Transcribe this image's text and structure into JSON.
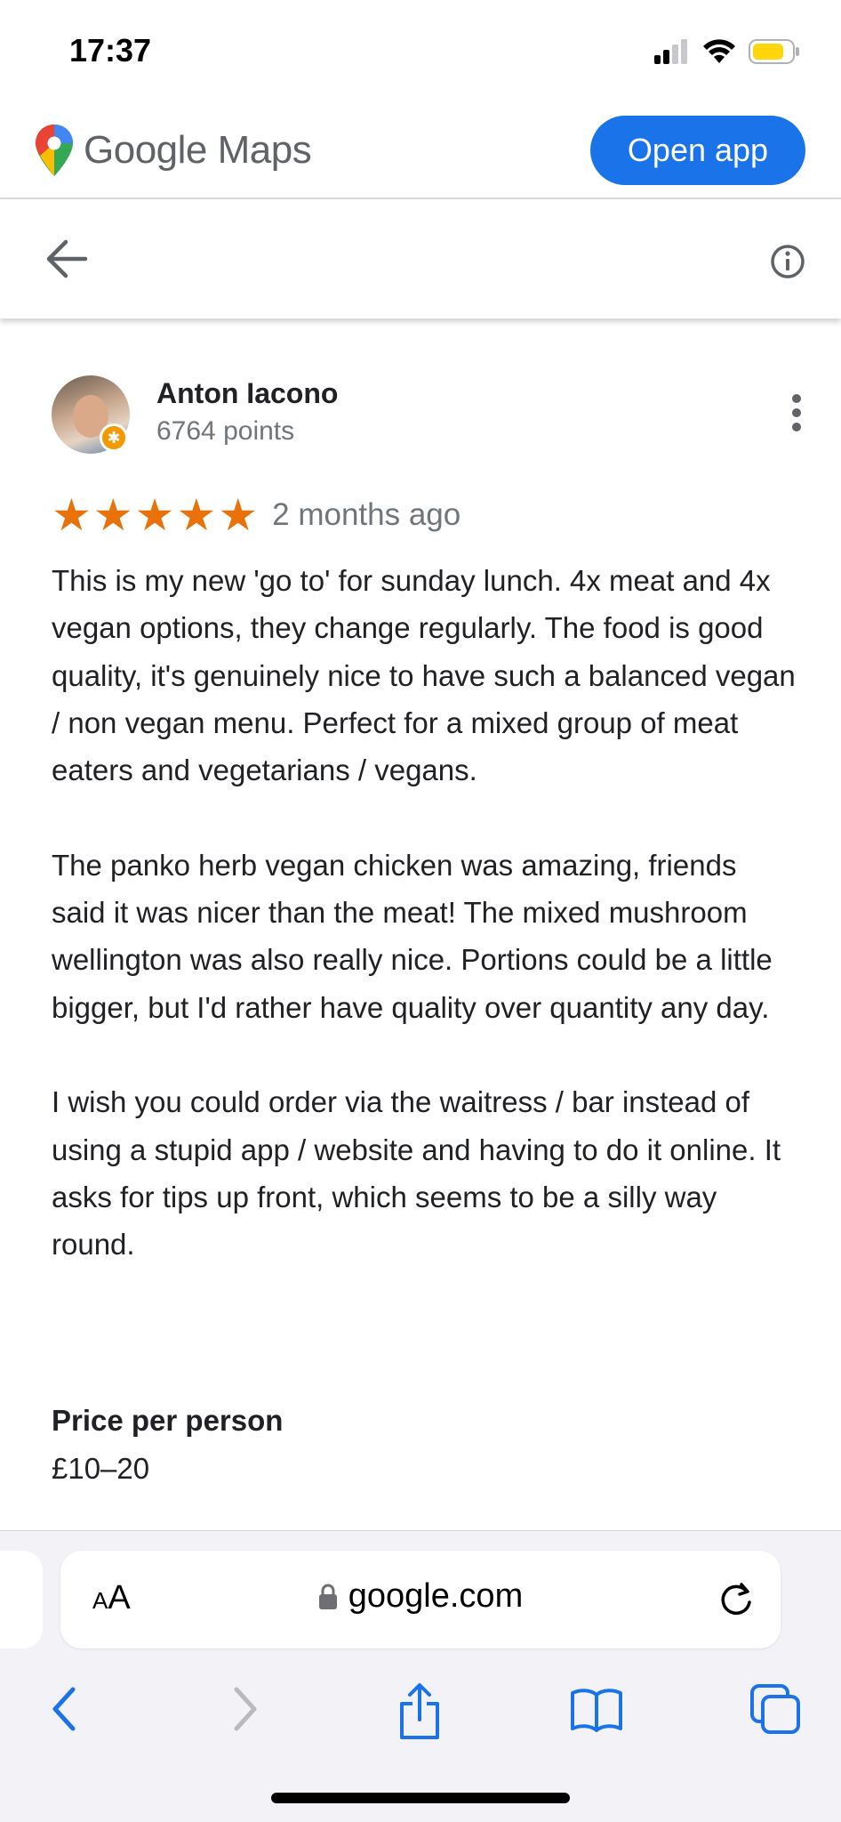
{
  "status_bar": {
    "time": "17:37",
    "icons": [
      "signal-icon",
      "wifi-icon",
      "battery-icon"
    ]
  },
  "header": {
    "brand": "Google Maps",
    "open_app_label": "Open app"
  },
  "nav": {
    "icons": [
      "back-arrow-icon",
      "info-icon"
    ]
  },
  "review": {
    "author": "Anton Iacono",
    "points": "6764 points",
    "rating": 5,
    "rating_max": 5,
    "date": "2 months ago",
    "paragraphs": [
      "This is my new 'go to' for sunday lunch. 4x meat and 4x vegan options, they change regularly. The food is good quality, it's genuinely nice to have such a balanced vegan / non vegan menu. Perfect for a mixed group of meat eaters and vegetarians / vegans.",
      "The panko herb vegan chicken was amazing, friends said it was nicer than the meat! The mixed mushroom wellington was also really nice. Portions could be a little bigger, but I'd rather have quality over quantity any day.",
      "I wish you could order via the waitress / bar instead of using a stupid app / website and having to do it online. It asks for tips up front, which seems to be a silly way round."
    ],
    "price_label": "Price per person",
    "price_value": "£10–20"
  },
  "browser": {
    "aa_label": "AA",
    "url": "google.com",
    "toolbar_icons": [
      "back-icon",
      "forward-icon",
      "share-icon",
      "bookmarks-icon",
      "tabs-icon"
    ]
  },
  "colors": {
    "accent": "#1a73e8",
    "star": "#e8710a",
    "secondary_text": "#70757a",
    "battery": "#ffd60a"
  }
}
